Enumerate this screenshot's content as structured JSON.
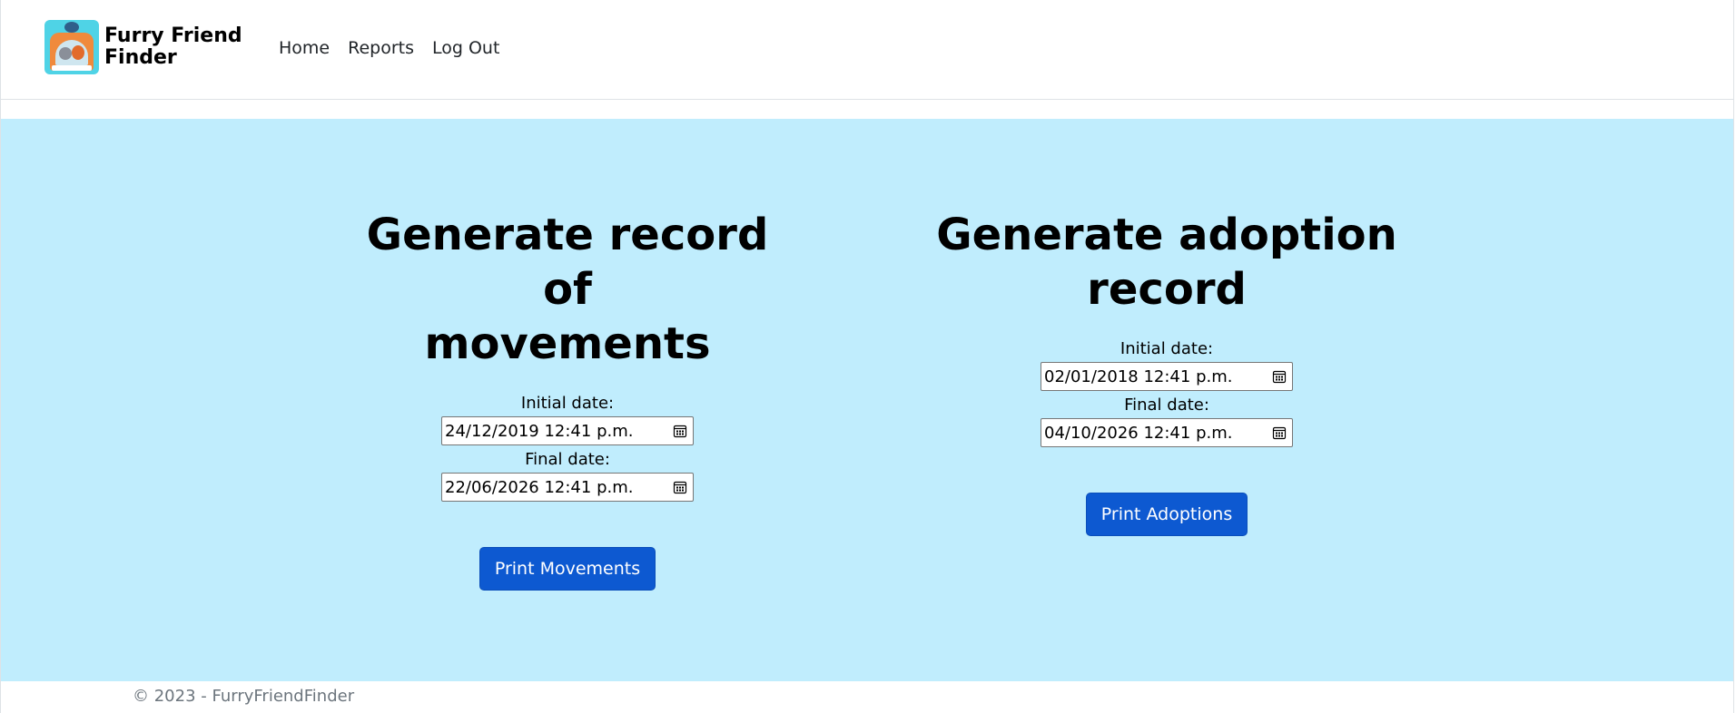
{
  "navbar": {
    "brand_line1": "Furry Friend",
    "brand_line2": "Finder",
    "links": [
      "Home",
      "Reports",
      "Log Out"
    ]
  },
  "movements": {
    "title_line1": "Generate record of",
    "title_line2": "movements",
    "initial_label": "Initial date:",
    "initial_value": "24/12/2019 12:41 p.m.",
    "final_label": "Final date:",
    "final_value": "22/06/2026 12:41 p.m.",
    "button": "Print Movements"
  },
  "adoptions": {
    "title": "Generate adoption record",
    "initial_label": "Initial date:",
    "initial_value": "02/01/2018 12:41 p.m.",
    "final_label": "Final date:",
    "final_value": "04/10/2026 12:41 p.m.",
    "button": "Print Adoptions"
  },
  "footer": {
    "text": "© 2023 - FurryFriendFinder"
  },
  "colors": {
    "main_bg": "#c0edfd",
    "button_bg": "#0d59d1"
  }
}
